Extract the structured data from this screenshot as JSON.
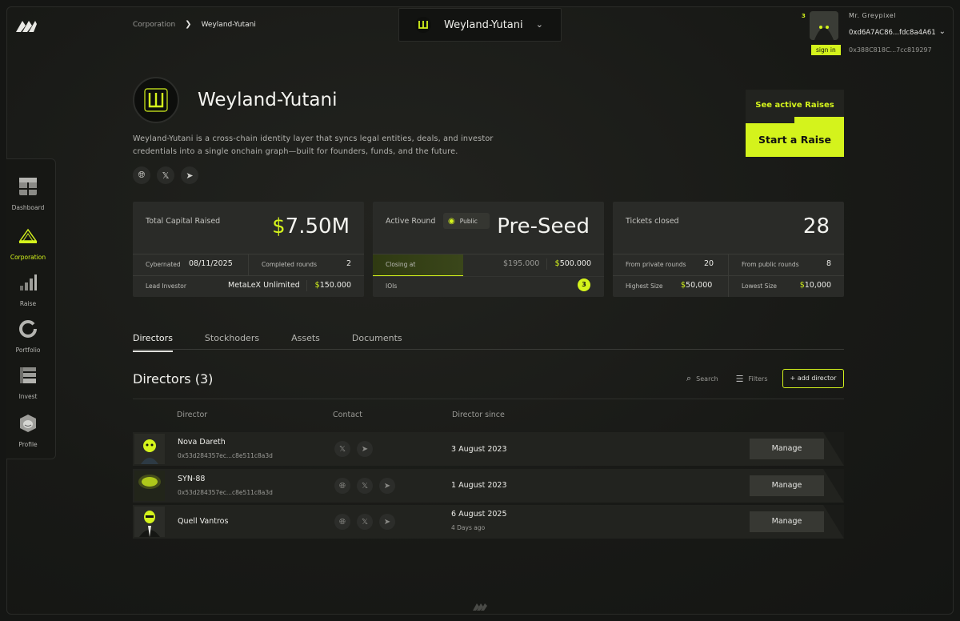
{
  "breadcrumb": {
    "parent": "Corporation",
    "current": "Weyland-Yutani",
    "separator": "❯"
  },
  "org_switch": {
    "name": "Weyland-Yutani"
  },
  "user": {
    "count": "3",
    "name": "Mr. Greypixel",
    "address_primary": "0xd6A7AC86...fdc8a4A61",
    "sign_in": "sign in",
    "address_secondary": "0x388C818C...7cc819297"
  },
  "sidebar": {
    "items": [
      {
        "label": "Dashboard",
        "icon": "dashboard-icon"
      },
      {
        "label": "Corporation",
        "icon": "corporation-icon"
      },
      {
        "label": "Raise",
        "icon": "raise-icon"
      },
      {
        "label": "Portfolio",
        "icon": "portfolio-icon"
      },
      {
        "label": "Invest",
        "icon": "invest-icon"
      },
      {
        "label": "Profile",
        "icon": "profile-icon"
      }
    ]
  },
  "company": {
    "name": "Weyland-Yutani",
    "description": "Weyland-Yutani is a cross-chain identity layer that syncs legal entities, deals, and investor credentials into a single onchain graph—built for founders, funds, and the future."
  },
  "cta": {
    "see_raises": "See active Raises",
    "start_raise": "Start a Raise"
  },
  "cards": {
    "capital": {
      "title": "Total Capital Raised",
      "value_prefix": "$",
      "value": "7.50M",
      "cybernated_label": "Cybernated",
      "cybernated_value": "08/11/2025",
      "completed_label": "Completed rounds",
      "completed_value": "2",
      "lead_label": "Lead Investor",
      "lead_value": "MetaLeX Unlimited",
      "lead_amount_prefix": "$",
      "lead_amount": "150.000"
    },
    "round": {
      "title": "Active Round",
      "visibility": "Public",
      "value": "Pre-Seed",
      "closing_label": "Closing at",
      "raised": "$195.000",
      "target_prefix": "$",
      "target": "500.000",
      "progress": 0.39,
      "iois_label": "IOIs",
      "iois_value": "3"
    },
    "tickets": {
      "title": "Tickets closed",
      "value": "28",
      "private_label": "From private rounds",
      "private_value": "20",
      "public_label": "From public rounds",
      "public_value": "8",
      "highest_label": "Highest Size",
      "highest_prefix": "$",
      "highest_value": "50,000",
      "lowest_label": "Lowest Size",
      "lowest_prefix": "$",
      "lowest_value": "10,000"
    }
  },
  "tabs": [
    "Directors",
    "Stockhoders",
    "Assets",
    "Documents"
  ],
  "directors": {
    "title": "Directors (3)",
    "search": "Search",
    "filters": "Filters",
    "add": "+ add director",
    "columns": {
      "director": "Director",
      "contact": "Contact",
      "since": "Director since"
    },
    "rows": [
      {
        "name": "Nova Dareth",
        "address": "0x53d284357ec...c8e511c8a3d",
        "since": "3 August 2023",
        "ago": "",
        "contacts": [
          "x-icon",
          "telegram-icon"
        ],
        "manage": "Manage"
      },
      {
        "name": "SYN-88",
        "address": "0x53d284357ec...c8e511c8a3d",
        "since": "1 August 2023",
        "ago": "",
        "contacts": [
          "globe-icon",
          "x-icon",
          "telegram-icon"
        ],
        "manage": "Manage"
      },
      {
        "name": "Quell Vantros",
        "address": "",
        "since": "6 August 2025",
        "ago": "4 Days ago",
        "contacts": [
          "globe-icon",
          "x-icon",
          "telegram-icon"
        ],
        "manage": "Manage"
      }
    ]
  },
  "colors": {
    "accent": "#d4f31c",
    "background": "#151614",
    "card": "#2a2b28"
  }
}
